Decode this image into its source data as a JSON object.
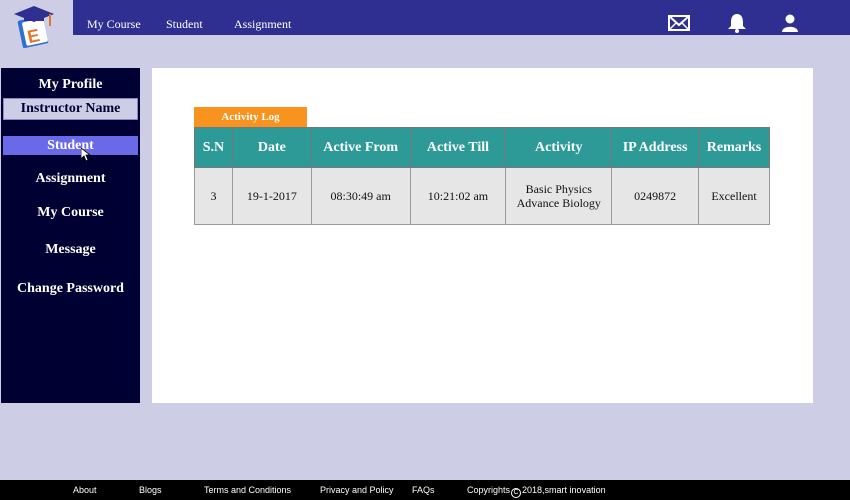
{
  "colors": {
    "topbar": "#2e2f91",
    "sidebar": "#000033",
    "accent_orange": "#f7931e",
    "table_header": "#2e9a98",
    "active_item": "#6a6ae8"
  },
  "nav": {
    "links": [
      "My Course",
      "Student",
      "Assignment"
    ],
    "icons": [
      "mail-icon",
      "bell-icon",
      "user-icon"
    ]
  },
  "sidebar": {
    "title": "My Profile",
    "instructor": "Instructor Name",
    "items": [
      {
        "label": "Student",
        "active": true
      },
      {
        "label": "Assignment"
      },
      {
        "label": "My Course"
      },
      {
        "label": "Message"
      },
      {
        "label": "Change Password"
      }
    ]
  },
  "main": {
    "tab_label": "Activity Log",
    "table": {
      "headers": [
        "S.N",
        "Date",
        "Active From",
        "Active Till",
        "Activity",
        "IP Address",
        "Remarks"
      ],
      "rows": [
        {
          "sn": "3",
          "date": "19-1-2017",
          "active_from": "08:30:49 am",
          "active_till": "10:21:02 am",
          "activity_line1": "Basic Physics",
          "activity_line2": "Advance Biology",
          "ip": "0249872",
          "remarks": "Excellent"
        }
      ]
    }
  },
  "footer": {
    "links": [
      "About",
      "Blogs",
      "Terms and Conditions",
      "Privacy and Policy",
      "FAQs"
    ],
    "copyright_prefix": "Copyrights",
    "copyright_symbol": "C",
    "copyright_suffix": "2018,smart inovation"
  }
}
